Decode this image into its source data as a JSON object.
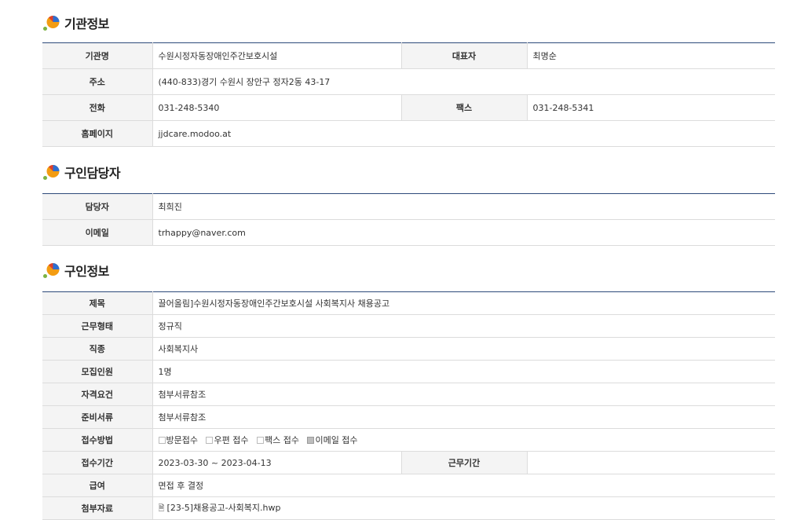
{
  "sections": {
    "org": {
      "title": "기관정보",
      "rows": {
        "name_label": "기관명",
        "name_value": "수원시정자동장애인주간보호시설",
        "rep_label": "대표자",
        "rep_value": "최명순",
        "addr_label": "주소",
        "addr_value": "(440-833)경기 수원시 장안구 정자2동 43-17",
        "tel_label": "전화",
        "tel_value": "031-248-5340",
        "fax_label": "팩스",
        "fax_value": "031-248-5341",
        "home_label": "홈페이지",
        "home_value": "jjdcare.modoo.at"
      }
    },
    "contact": {
      "title": "구인담당자",
      "rows": {
        "person_label": "담당자",
        "person_value": "최희진",
        "email_label": "이메일",
        "email_value": "trhappy@naver.com"
      }
    },
    "job": {
      "title": "구인정보",
      "rows": {
        "subject_label": "제목",
        "subject_value": "끌어올림]수원시정자동장애인주간보호시설 사회복지사 채용공고",
        "worktype_label": "근무형태",
        "worktype_value": "정규직",
        "category_label": "직종",
        "category_value": "사회복지사",
        "headcount_label": "모집인원",
        "headcount_value": "1명",
        "qual_label": "자격요건",
        "qual_value": "첨부서류참조",
        "docs_label": "준비서류",
        "docs_value": "첨부서류참조",
        "method_label": "접수방법",
        "methods": [
          {
            "label": "방문접수",
            "checked": false
          },
          {
            "label": "우편 접수",
            "checked": false
          },
          {
            "label": "팩스 접수",
            "checked": false
          },
          {
            "label": "이메일 접수",
            "checked": true
          }
        ],
        "period_label": "접수기간",
        "period_value": "2023-03-30 ~ 2023-04-13",
        "workperiod_label": "근무기간",
        "workperiod_value": "",
        "salary_label": "급여",
        "salary_value": "면접 후 결정",
        "attach_label": "첨부자료",
        "attach_value": "[23-5]채용공고-사회복지.hwp"
      }
    }
  },
  "colors": {
    "table_top_border": "#2d4a7a",
    "header_bg": "#f4f4f4",
    "row_border": "#dcdcdc"
  }
}
